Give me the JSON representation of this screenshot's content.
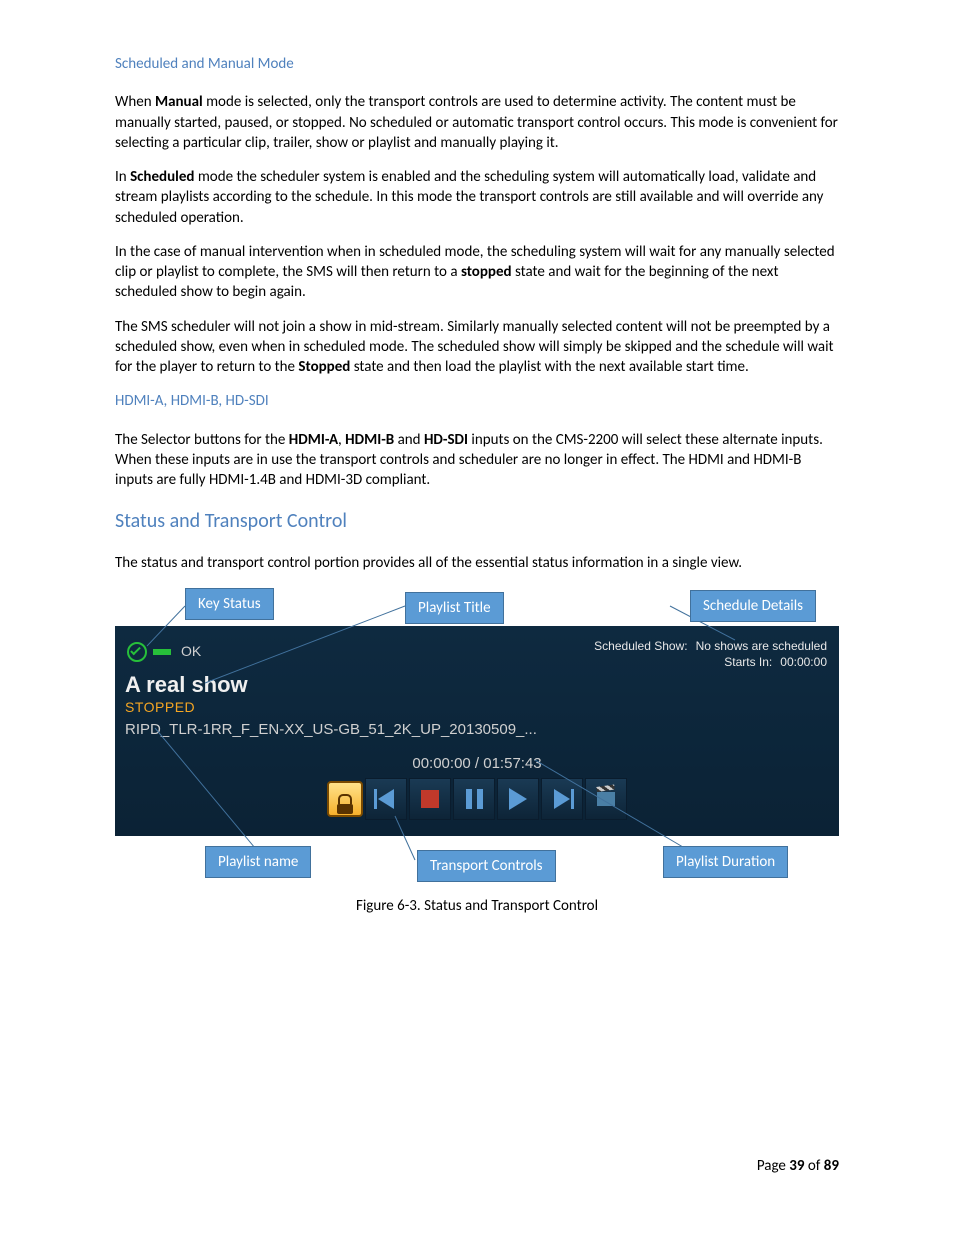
{
  "headings": {
    "scheduled_manual": "Scheduled and Manual Mode",
    "hdmi": "HDMI-A, HDMI-B, HD-SDI",
    "status_transport": "Status and Transport Control"
  },
  "paragraphs": {
    "p1_a": "When ",
    "p1_b": "Manual",
    "p1_c": " mode is selected, only the transport controls are used to determine activity.  The content must be manually started, paused, or stopped.  No scheduled or automatic transport control occurs.  This mode is convenient for selecting a particular clip, trailer, show or playlist and manually playing it.",
    "p2_a": "In ",
    "p2_b": "Scheduled",
    "p2_c": " mode the scheduler system is enabled and the scheduling system will automatically load, validate and stream playlists according to the schedule.  In this mode the transport controls are still available and will override any scheduled operation.",
    "p3_a": "In the case of manual intervention when in scheduled mode, the scheduling system will wait for any manually selected clip or playlist to complete, the SMS will then return to a ",
    "p3_b": "stopped",
    "p3_c": " state and wait for the beginning of the next scheduled show to begin again.",
    "p4_a": "The SMS scheduler will not join a show in mid-stream.  Similarly manually selected content will not be preempted by a scheduled show, even when in scheduled mode.  The scheduled show will simply be skipped and the schedule will wait for the player to return to the ",
    "p4_b": "Stopped",
    "p4_c": " state and then load the playlist with the next available start time.",
    "p5_a": "The Selector buttons for the ",
    "p5_b": "HDMI-A",
    "p5_c": ", ",
    "p5_d": "HDMI-B",
    "p5_e": " and ",
    "p5_f": "HD-SDI",
    "p5_g": " inputs on the CMS-2200 will select these alternate inputs.  When these inputs are in use the transport controls and scheduler are no longer in effect.  The HDMI and HDMI-B inputs are fully HDMI-1.4B and HDMI-3D compliant.",
    "p6": "The status and transport control portion provides all of the essential status information in a single view."
  },
  "callouts": {
    "key_status": "Key Status",
    "playlist_title": "Playlist Title",
    "schedule_details": "Schedule Details",
    "playlist_name": "Playlist name",
    "transport_controls": "Transport Controls",
    "playlist_duration": "Playlist Duration"
  },
  "panel": {
    "ok": "OK",
    "scheduled_show_label": "Scheduled Show:",
    "scheduled_show_value": "No shows are scheduled",
    "starts_in_label": "Starts In:",
    "starts_in_value": "00:00:00",
    "title": "A real show",
    "state": "STOPPED",
    "clip": "RIPD_TLR-1RR_F_EN-XX_US-GB_51_2K_UP_20130509_...",
    "time": "00:00:00 / 01:57:43"
  },
  "caption": "Figure 6-3.  Status and Transport Control",
  "footer": {
    "a": "Page ",
    "b": "39",
    "c": " of ",
    "d": "89"
  }
}
